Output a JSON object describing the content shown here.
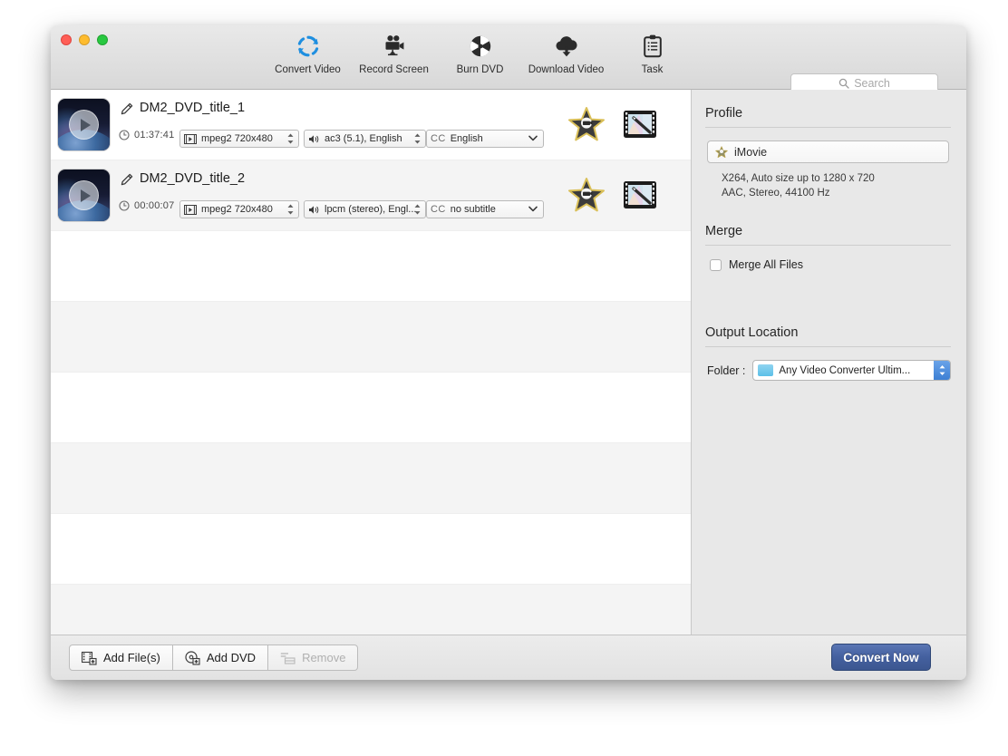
{
  "window": {
    "traffic_lights": [
      "close",
      "minimize",
      "zoom"
    ]
  },
  "toolbar": {
    "items": [
      {
        "label": "Convert Video",
        "icon": "refresh-circular-icon"
      },
      {
        "label": "Record Screen",
        "icon": "video-camera-icon"
      },
      {
        "label": "Burn DVD",
        "icon": "disc-burn-icon"
      },
      {
        "label": "Download Video",
        "icon": "cloud-download-icon"
      },
      {
        "label": "Task",
        "icon": "clipboard-icon"
      }
    ],
    "search": {
      "placeholder": "Search",
      "icon": "search-icon"
    }
  },
  "file_list": {
    "rows": [
      {
        "name": "DM2_DVD_title_1",
        "duration": "01:37:41",
        "video_track": "mpeg2 720x480",
        "audio_track": "ac3 (5.1), English",
        "subtitle_badge": "CC",
        "subtitle_track": "English"
      },
      {
        "name": "DM2_DVD_title_2",
        "duration": "00:00:07",
        "video_track": "mpeg2 720x480",
        "audio_track": "lpcm (stereo), Engl...",
        "subtitle_badge": "CC",
        "subtitle_track": "no subtitle"
      }
    ]
  },
  "side_panel": {
    "profile": {
      "title": "Profile",
      "selected": "iMovie",
      "description_line1": "X264, Auto size up to 1280 x 720",
      "description_line2": "AAC, Stereo, 44100 Hz"
    },
    "merge": {
      "title": "Merge",
      "checkbox_label": "Merge All Files",
      "checked": false
    },
    "output": {
      "title": "Output Location",
      "folder_label": "Folder :",
      "folder_value": "Any Video Converter Ultim..."
    }
  },
  "bottom_bar": {
    "add_files_label": "Add File(s)",
    "add_dvd_label": "Add DVD",
    "remove_label": "Remove",
    "convert_label": "Convert Now"
  },
  "colors": {
    "accent_blue": "#44609f",
    "convert_icon_blue": "#1f8fe0",
    "folder_blue": "#5cc0e8"
  }
}
